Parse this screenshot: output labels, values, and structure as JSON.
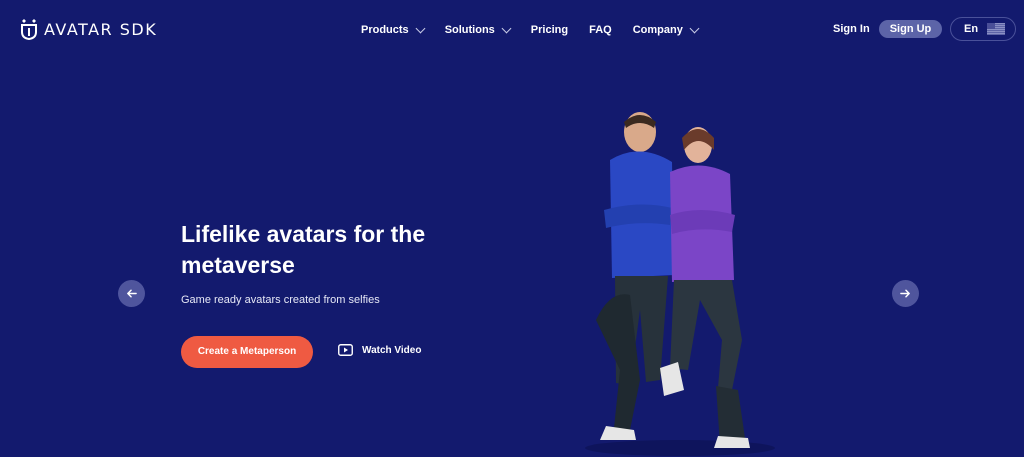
{
  "header": {
    "logo_text": "AVATAR SDK",
    "nav": [
      {
        "label": "Products",
        "has_dropdown": true
      },
      {
        "label": "Solutions",
        "has_dropdown": true
      },
      {
        "label": "Pricing",
        "has_dropdown": false
      },
      {
        "label": "FAQ",
        "has_dropdown": false
      },
      {
        "label": "Company",
        "has_dropdown": true
      }
    ],
    "sign_in": "Sign In",
    "sign_up": "Sign Up",
    "language": "En"
  },
  "hero": {
    "title": "Lifelike avatars for the metaverse",
    "subtitle": "Game ready avatars created from selfies",
    "cta_label": "Create a Metaperson",
    "watch_label": "Watch Video"
  },
  "colors": {
    "background": "#131a6e",
    "cta": "#ef5a42",
    "signup": "#5c64a8",
    "arrow_button": "#4f559d"
  },
  "icons": {
    "logo": "avatar-sdk-logo-icon",
    "nav_dropdown": "chevron-down-icon",
    "watch": "play-icon",
    "prev": "arrow-left-icon",
    "next": "arrow-right-icon",
    "language": "flag-icon"
  }
}
